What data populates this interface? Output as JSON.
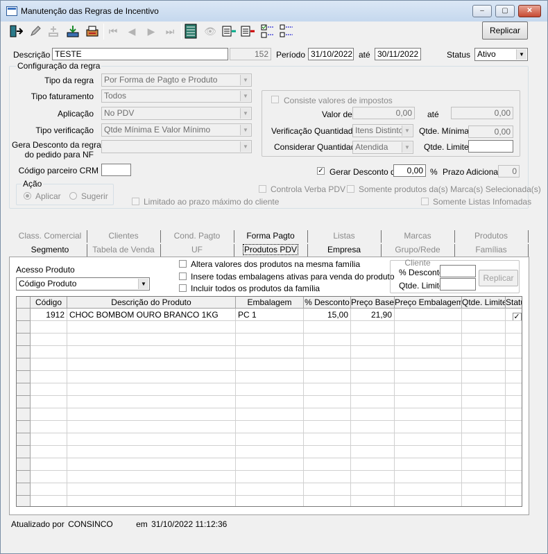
{
  "window": {
    "title": "Manutenção das Regras de Incentivo",
    "min": "–",
    "max": "▢",
    "close": "✕"
  },
  "toolbar": {
    "icons": [
      "exit-icon",
      "edit-icon",
      "add-icon",
      "save-icon",
      "print-icon",
      "first-icon",
      "previous-icon",
      "next-icon",
      "last-icon",
      "list-icon",
      "find-icon",
      "export-icon",
      "import-icon",
      "check-list-icon",
      "tree-icon"
    ],
    "replicar": "Replicar"
  },
  "header": {
    "descricao_label": "Descrição",
    "descricao_value": "TESTE",
    "code": "152",
    "periodo_label": "Período",
    "periodo_inicio": "31/10/2022",
    "ate_label": "até",
    "periodo_fim": "30/11/2022",
    "status_label": "Status",
    "status_value": "Ativo"
  },
  "config": {
    "title": "Configuração da regra",
    "tipo_regra_label": "Tipo da regra",
    "tipo_regra": "Por Forma de Pagto e Produto",
    "tipo_fat_label": "Tipo faturamento",
    "tipo_fat": "Todos",
    "aplicacao_label": "Aplicação",
    "aplicacao": "No PDV",
    "tipo_ver_label": "Tipo verificação",
    "tipo_ver": "Qtde Mínima E Valor Mínimo",
    "gera_label_1": "Gera Desconto da regra",
    "gera_label_2": "do pedido para NF",
    "gera": "",
    "crm_label": "Código parceiro CRM",
    "crm": "",
    "impostos": {
      "consiste_label": "Consiste valores de impostos",
      "valor_de_label": "Valor de",
      "valor_de": "0,00",
      "ate_label": "até",
      "valor_ate": "0,00",
      "ver_qtd_label": "Verificação Quantidade",
      "ver_qtd": "Itens Distintos",
      "qtde_min_label": "Qtde. Mínima",
      "qtde_min": "0,00",
      "cons_qtd_label": "Considerar Quantidade",
      "cons_qtd": "Atendida",
      "qtde_lim_label": "Qtde. Limite",
      "qtde_lim": ""
    },
    "gerar_desc_label": "Gerar Desconto de",
    "gerar_desc": "0,00",
    "pct": "%",
    "prazo_label": "Prazo Adicional",
    "prazo": "0",
    "acao_title": "Ação",
    "aplicar": "Aplicar",
    "sugerir": "Sugerir",
    "controla_verba": "Controla Verba PDV",
    "somente_marcas": "Somente produtos da(s) Marca(s) Selecionada(s)",
    "limitado_prazo": "Limitado ao prazo máximo do cliente",
    "somente_listas": "Somente Listas Infomadas"
  },
  "tabs_row1": [
    "Class. Comercial",
    "Clientes",
    "Cond. Pagto",
    "Forma Pagto",
    "Listas",
    "Marcas",
    "Produtos"
  ],
  "tabs_row2": [
    "Segmento",
    "Tabela de Venda",
    "UF",
    "Produtos PDV",
    "Empresa",
    "Grupo/Rede Cliente",
    "Famílias"
  ],
  "produtos": {
    "acesso_label": "Acesso Produto",
    "acesso_value": "Código Produto",
    "altera": "Altera valores dos produtos na mesma família",
    "insere": "Insere todas embalagens ativas para venda do produto",
    "incluir": "Incluir todos os produtos da família",
    "pct_desc_label": "% Desconto",
    "qtde_lim_label": "Qtde. Limite",
    "replicar": "Replicar",
    "columns": [
      "Código",
      "Descrição do Produto",
      "Embalagem",
      "% Desconto",
      "Preço Base",
      "Preço Embalagem",
      "Qtde. Limite",
      "Status"
    ],
    "rows": [
      {
        "codigo": "1912",
        "descricao": "CHOC BOMBOM OURO BRANCO 1KG",
        "embalagem": "PC  1",
        "desconto": "15,00",
        "preco_base": "21,90",
        "preco_emb": "",
        "qtde_lim": "",
        "status": "✓"
      }
    ]
  },
  "statusbar": {
    "atualizado_label": "Atualizado por",
    "user": "CONSINCO",
    "em_label": "em",
    "datetime": "31/10/2022 11:12:36"
  }
}
